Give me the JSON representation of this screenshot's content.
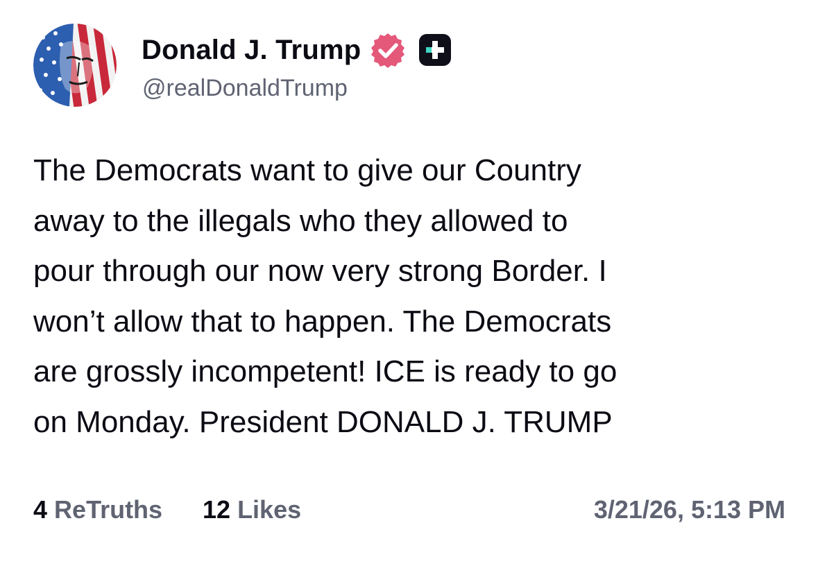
{
  "profile": {
    "display_name": "Donald J. Trump",
    "handle": "@realDonaldTrump",
    "avatar_icon": "flag-portrait-avatar",
    "badges": [
      "verified-badge-icon",
      "plus-badge-icon"
    ]
  },
  "post": {
    "text": "The Democrats want to give our Country\naway to the illegals who they allowed to\npour through our now very strong Border. I\nwon’t allow that to happen. The Democrats\nare grossly incompetent! ICE is ready to go\non Monday. President DONALD J. TRUMP"
  },
  "stats": {
    "retruths_count": "4",
    "retruths_label": "ReTruths",
    "likes_count": "12",
    "likes_label": "Likes",
    "timestamp": "3/21/26, 5:13 PM"
  },
  "colors": {
    "text_primary": "#0b0b14",
    "text_secondary": "#5f6372",
    "verified_pink": "#e4587a",
    "plus_badge_bg": "#0f0f1a",
    "plus_badge_cross": "#3fd6c4"
  }
}
